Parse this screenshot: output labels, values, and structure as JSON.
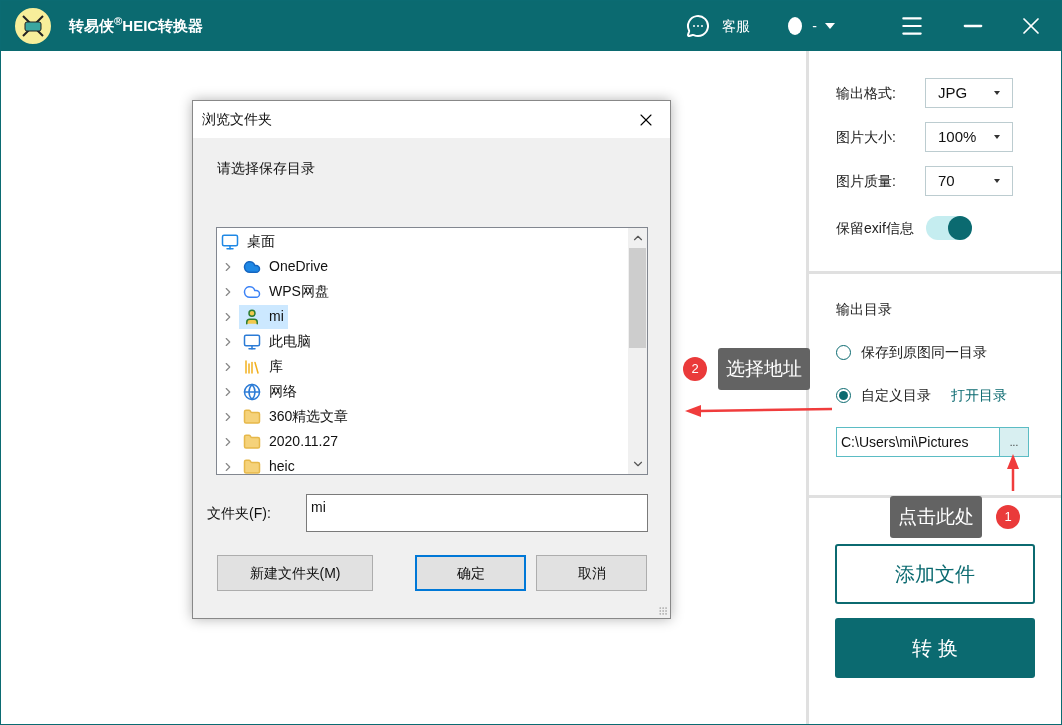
{
  "app": {
    "title": "转易侠$^{®}$HEIC转换器",
    "support": "客服",
    "account": "-"
  },
  "settings": [
    {
      "label": "输出格式:",
      "value": "JPG"
    },
    {
      "label": "图片大小:",
      "value": "100%"
    },
    {
      "label": "图片质量:",
      "value": "70"
    }
  ],
  "exif": {
    "label": "保留exif信息",
    "on": true
  },
  "output": {
    "heading": "输出目录",
    "options": [
      {
        "label": "保存到原图同一目录",
        "selected": false
      },
      {
        "label": "自定义目录",
        "selected": true
      }
    ],
    "open_link": "打开目录",
    "path": "C:\\Users\\mi\\Pictures",
    "browse": "..."
  },
  "actions": {
    "add": "添加文件",
    "convert": "转 换"
  },
  "dialog": {
    "title": "浏览文件夹",
    "prompt": "请选择保存目录",
    "tree": [
      {
        "label": "桌面",
        "kind": "desktop",
        "expandable": false,
        "selected": false
      },
      {
        "label": "OneDrive",
        "kind": "cloud",
        "expandable": true,
        "selected": false
      },
      {
        "label": "WPS网盘",
        "kind": "cloud-outline",
        "expandable": true,
        "selected": false
      },
      {
        "label": "mi",
        "kind": "user",
        "expandable": true,
        "selected": true
      },
      {
        "label": "此电脑",
        "kind": "computer",
        "expandable": true,
        "selected": false
      },
      {
        "label": "库",
        "kind": "library",
        "expandable": true,
        "selected": false
      },
      {
        "label": "网络",
        "kind": "network",
        "expandable": true,
        "selected": false
      },
      {
        "label": "360精选文章",
        "kind": "folder",
        "expandable": true,
        "selected": false
      },
      {
        "label": "2020.11.27",
        "kind": "folder",
        "expandable": true,
        "selected": false
      },
      {
        "label": "heic",
        "kind": "folder",
        "expandable": true,
        "selected": false
      }
    ],
    "folder_label": "文件夹(F):",
    "folder_value": "mi",
    "buttons": [
      {
        "label": "新建文件夹(M)",
        "default": false
      },
      {
        "label": "确定",
        "default": true
      },
      {
        "label": "取消",
        "default": false
      }
    ]
  },
  "annotations": [
    {
      "number": "1",
      "text": "点击此处"
    },
    {
      "number": "2",
      "text": "选择地址"
    }
  ]
}
